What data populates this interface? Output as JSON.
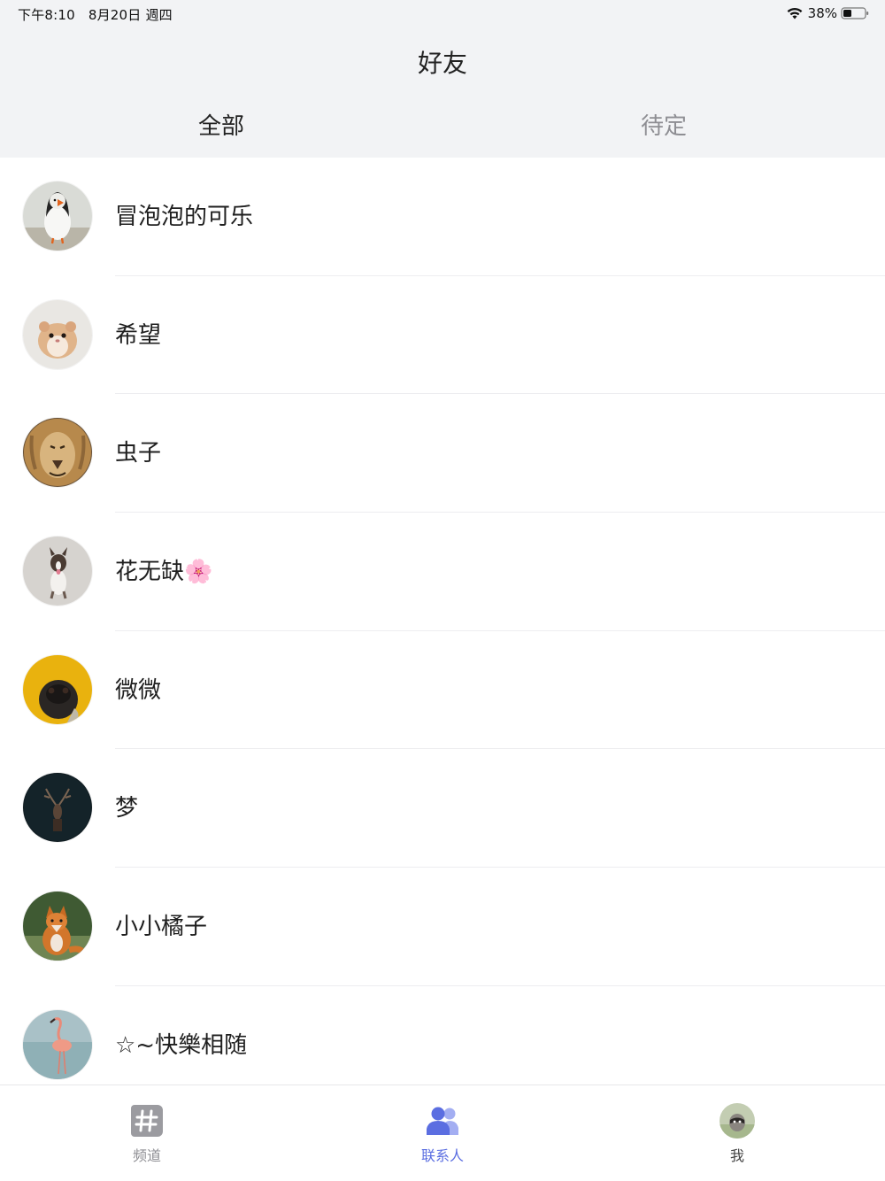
{
  "status_bar": {
    "time": "下午8:10",
    "date": "8月20日 週四",
    "battery": "38%"
  },
  "header": {
    "title": "好友",
    "tabs": [
      {
        "label": "全部",
        "selected": true
      },
      {
        "label": "待定",
        "selected": false
      }
    ]
  },
  "contacts": [
    {
      "name": "冒泡泡的可乐",
      "avatar_icon": "puffin-avatar"
    },
    {
      "name": "希望",
      "avatar_icon": "hamster-avatar"
    },
    {
      "name": "虫子",
      "avatar_icon": "lion-avatar"
    },
    {
      "name": "花无缺🌸",
      "avatar_icon": "dog-avatar"
    },
    {
      "name": "微微",
      "avatar_icon": "pug-avatar"
    },
    {
      "name": "梦",
      "avatar_icon": "deer-avatar"
    },
    {
      "name": "小小橘子",
      "avatar_icon": "fox-avatar"
    },
    {
      "name": "☆~快樂相随",
      "avatar_icon": "flamingo-avatar"
    }
  ],
  "tab_bar": {
    "items": [
      {
        "label": "频道",
        "icon": "hash-icon",
        "active": false
      },
      {
        "label": "联系人",
        "icon": "contacts-icon",
        "active": true
      },
      {
        "label": "我",
        "icon": "avatar",
        "active": false
      }
    ]
  },
  "colors": {
    "header_bg": "#f2f3f5",
    "active_tab": "#5b6ee1",
    "inactive_tab": "#8e8e93"
  }
}
